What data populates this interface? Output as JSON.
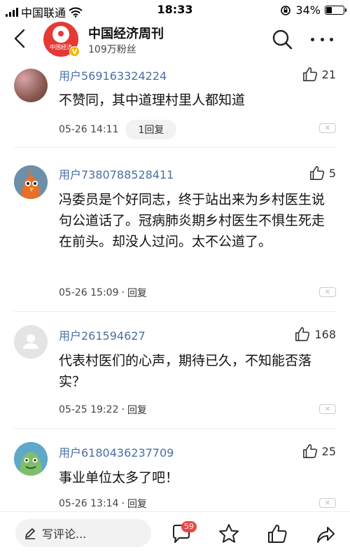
{
  "status_bar": {
    "carrier": "中国联通",
    "time": "18:33",
    "battery": "34%",
    "battery_level": 0.34
  },
  "header": {
    "title": "中国经济周刊",
    "followers": "109万粉丝",
    "avatar_text": "中国经济"
  },
  "comments": [
    {
      "user": "用户569163324224",
      "likes": "21",
      "text": "不赞同，其中道理村里人都知道",
      "date": "05-26 14:11",
      "reply": "1回复"
    },
    {
      "user": "用户7380788528411",
      "likes": "5",
      "text": "冯委员是个好同志，终于站出来为乡村医生说句公道话了。冠病肺炎期乡村医生不惧生死走在前头。却没人过问。太不公道了。",
      "date": "05-26 15:09",
      "reply": "回复"
    },
    {
      "user": "用户261594627",
      "likes": "168",
      "text": "代表村医们的心声，期待已久，不知能否落实？",
      "date": "05-25 19:22",
      "reply": "回复"
    },
    {
      "user": "用户6180436237709",
      "likes": "25",
      "text": "事业单位太多了吧！",
      "date": "05-26 13:14",
      "reply": "回复"
    }
  ],
  "meta_separator": "·",
  "bottom_bar": {
    "write_placeholder": "写评论...",
    "comment_count": "59"
  },
  "icons": [
    "back-arrow-icon",
    "search-icon",
    "more-icon",
    "thumb-up-icon",
    "close-icon",
    "pencil-icon",
    "comment-icon",
    "star-icon",
    "share-icon"
  ],
  "colors": {
    "username": "#4a6fa5",
    "badge": "#ee4444",
    "brand": "#e53935"
  }
}
